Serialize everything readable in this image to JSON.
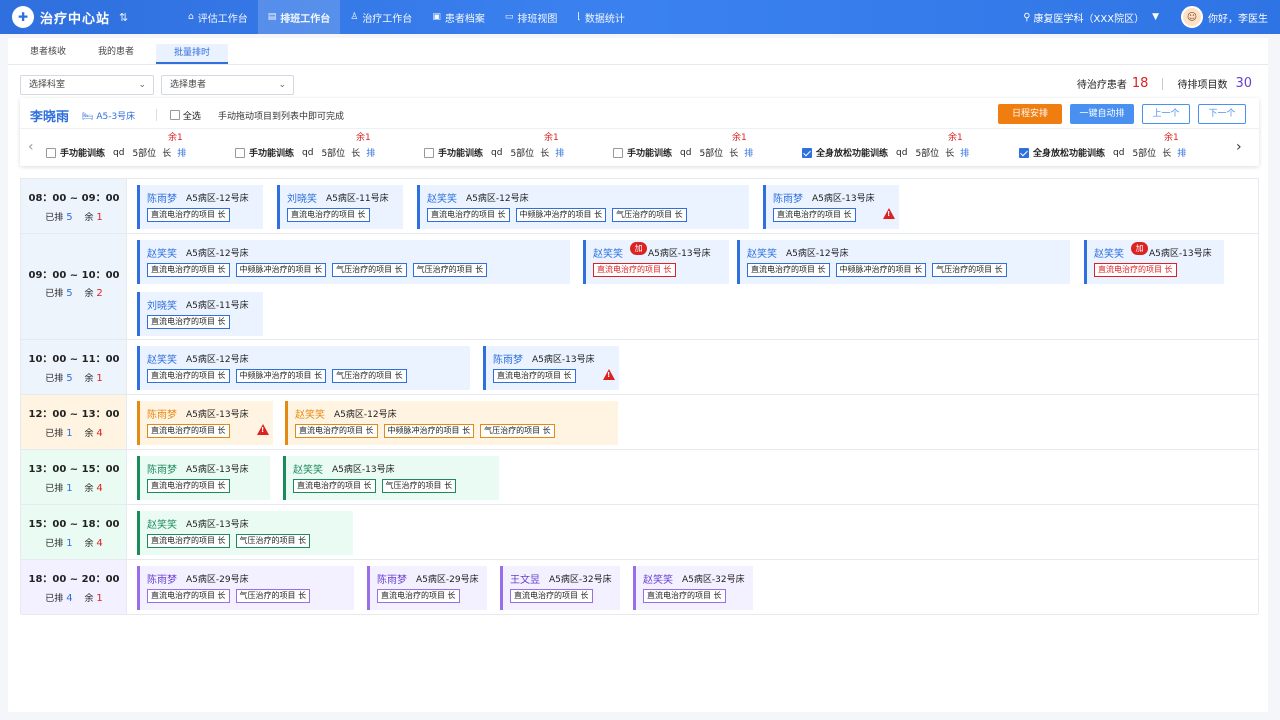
{
  "app": {
    "title": "治疗中心站",
    "swap_icon": "swap-icon"
  },
  "nav": [
    {
      "label": "评估工作台",
      "icon": "assessment-icon",
      "glyph": "⌂"
    },
    {
      "label": "排班工作台",
      "icon": "schedule-icon",
      "glyph": "▤",
      "active": true
    },
    {
      "label": "治疗工作台",
      "icon": "treatment-icon",
      "glyph": "♙"
    },
    {
      "label": "患者档案",
      "icon": "archive-icon",
      "glyph": "▣"
    },
    {
      "label": "排班视图",
      "icon": "view-icon",
      "glyph": "▭"
    },
    {
      "label": "数据统计",
      "icon": "stats-icon",
      "glyph": "⌊"
    }
  ],
  "header": {
    "hospital": "康复医学科（XXX院区）",
    "greeting": "你好，李医生"
  },
  "subtabs": [
    "患者核收",
    "我的患者",
    "批量排时"
  ],
  "filters": {
    "dept_placeholder": "选择科室",
    "patient_placeholder": "选择患者"
  },
  "counts": {
    "pending_patients_label": "待治疗患者",
    "pending_patients": "18",
    "pending_items_label": "待排项目数",
    "pending_items": "30"
  },
  "patient": {
    "name": "李晓雨",
    "bed": "A5-3号床",
    "select_all": "全选",
    "hint": "手动拖动项目到列表中即可完成",
    "buttons": {
      "arrange": "日程安排",
      "auto": "一键自动排",
      "prev": "上一个",
      "next": "下一个"
    },
    "programs": [
      {
        "remain": "余1",
        "name": "手功能训练",
        "freq": "qd",
        "parts": "5部位",
        "long": "长",
        "action": "排",
        "checked": false
      },
      {
        "remain": "余1",
        "name": "手功能训练",
        "freq": "qd",
        "parts": "5部位",
        "long": "长",
        "action": "排",
        "checked": false
      },
      {
        "remain": "余1",
        "name": "手功能训练",
        "freq": "qd",
        "parts": "5部位",
        "long": "长",
        "action": "排",
        "checked": false
      },
      {
        "remain": "余1",
        "name": "手功能训练",
        "freq": "qd",
        "parts": "5部位",
        "long": "长",
        "action": "排",
        "checked": false
      },
      {
        "remain": "余1",
        "name": "全身放松功能训练",
        "freq": "qd",
        "parts": "5部位",
        "long": "长",
        "action": "排",
        "checked": true
      },
      {
        "remain": "余1",
        "name": "全身放松功能训练",
        "freq": "qd",
        "parts": "5部位",
        "long": "长",
        "action": "排",
        "checked": true
      }
    ]
  },
  "schedule": [
    {
      "time": "08：00 ~ 09：00",
      "scheduled_label": "已排",
      "scheduled": "5",
      "remain_label": "余",
      "remain": "1",
      "color": "blue",
      "patients": [
        {
          "name": "陈雨梦",
          "bed": "A5病区-12号床",
          "items": [
            {
              "t": "直流电治疗的项目  长"
            }
          ]
        },
        {
          "name": "刘晓笑",
          "bed": "A5病区-11号床",
          "items": [
            {
              "t": "直流电治疗的项目  长"
            }
          ]
        },
        {
          "name": "赵笑笑",
          "bed": "A5病区-12号床",
          "items": [
            {
              "t": "直流电治疗的项目  长"
            },
            {
              "t": "中频脉冲治疗的项目  长"
            },
            {
              "t": "气压治疗的项目  长"
            }
          ]
        },
        {
          "name": "陈雨梦",
          "bed": "A5病区-13号床",
          "items": [
            {
              "t": "直流电治疗的项目  长"
            }
          ],
          "warn": true
        }
      ]
    },
    {
      "time": "09：00 ~ 10：00",
      "scheduled_label": "已排",
      "scheduled": "5",
      "remain_label": "余",
      "remain": "2",
      "color": "blue",
      "patients": [
        {
          "name": "赵笑笑",
          "bed": "A5病区-12号床",
          "items": [
            {
              "t": "直流电治疗的项目  长"
            },
            {
              "t": "中频脉冲治疗的项目  长"
            },
            {
              "t": "气压治疗的项目  长"
            },
            {
              "t": "气压治疗的项目  长"
            }
          ]
        },
        {
          "name": "赵笑笑",
          "bed": "A5病区-13号床",
          "jia": "加",
          "items": [
            {
              "t": "直流电治疗的项目  长",
              "red": true
            }
          ]
        },
        {
          "name": "赵笑笑",
          "bed": "A5病区-12号床",
          "items": [
            {
              "t": "直流电治疗的项目  长"
            },
            {
              "t": "中频脉冲治疗的项目  长"
            },
            {
              "t": "气压治疗的项目  长"
            }
          ]
        },
        {
          "name": "赵笑笑",
          "bed": "A5病区-13号床",
          "jia": "加",
          "items": [
            {
              "t": "直流电治疗的项目  长",
              "red": true
            }
          ]
        },
        {
          "name": "刘晓笑",
          "bed": "A5病区-11号床",
          "items": [
            {
              "t": "直流电治疗的项目  长"
            }
          ]
        }
      ]
    },
    {
      "time": "10：00 ~ 11：00",
      "scheduled_label": "已排",
      "scheduled": "5",
      "remain_label": "余",
      "remain": "1",
      "color": "blue",
      "patients": [
        {
          "name": "赵笑笑",
          "bed": "A5病区-12号床",
          "items": [
            {
              "t": "直流电治疗的项目  长"
            },
            {
              "t": "中频脉冲治疗的项目  长"
            },
            {
              "t": "气压治疗的项目  长"
            }
          ]
        },
        {
          "name": "陈雨梦",
          "bed": "A5病区-13号床",
          "items": [
            {
              "t": "直流电治疗的项目  长"
            }
          ],
          "warn": true
        }
      ]
    },
    {
      "time": "12：00 ~ 13：00",
      "scheduled_label": "已排",
      "scheduled": "1",
      "remain_label": "余",
      "remain": "4",
      "color": "orange",
      "patients": [
        {
          "name": "陈雨梦",
          "bed": "A5病区-13号床",
          "items": [
            {
              "t": "直流电治疗的项目  长"
            }
          ],
          "warn": true
        },
        {
          "name": "赵笑笑",
          "bed": "A5病区-12号床",
          "items": [
            {
              "t": "直流电治疗的项目  长"
            },
            {
              "t": "中频脉冲治疗的项目  长"
            },
            {
              "t": "气压治疗的项目  长"
            }
          ]
        }
      ]
    },
    {
      "time": "13：00 ~ 15：00",
      "scheduled_label": "已排",
      "scheduled": "1",
      "remain_label": "余",
      "remain": "4",
      "color": "green",
      "patients": [
        {
          "name": "陈雨梦",
          "bed": "A5病区-13号床",
          "items": [
            {
              "t": "直流电治疗的项目  长"
            }
          ]
        },
        {
          "name": "赵笑笑",
          "bed": "A5病区-13号床",
          "items": [
            {
              "t": "直流电治疗的项目  长"
            },
            {
              "t": "气压治疗的项目  长"
            }
          ]
        }
      ]
    },
    {
      "time": "15：00 ~ 18：00",
      "scheduled_label": "已排",
      "scheduled": "1",
      "remain_label": "余",
      "remain": "4",
      "color": "green",
      "patients": [
        {
          "name": "赵笑笑",
          "bed": "A5病区-13号床",
          "items": [
            {
              "t": "直流电治疗的项目  长"
            },
            {
              "t": "气压治疗的项目  长"
            }
          ]
        }
      ]
    },
    {
      "time": "18：00 ~ 20：00",
      "scheduled_label": "已排",
      "scheduled": "4",
      "remain_label": "余",
      "remain": "1",
      "color": "purple",
      "patients": [
        {
          "name": "陈雨梦",
          "bed": "A5病区-29号床",
          "items": [
            {
              "t": "直流电治疗的项目  长"
            },
            {
              "t": "气压治疗的项目  长"
            }
          ]
        },
        {
          "name": "陈雨梦",
          "bed": "A5病区-29号床",
          "items": [
            {
              "t": "直流电治疗的项目  长"
            }
          ]
        },
        {
          "name": "王文昱",
          "bed": "A5病区-32号床",
          "items": [
            {
              "t": "直流电治疗的项目  长"
            }
          ]
        },
        {
          "name": "赵笑笑",
          "bed": "A5病区-32号床",
          "items": [
            {
              "t": "直流电治疗的项目  长"
            }
          ]
        }
      ]
    }
  ],
  "colors": {
    "primary": "#2f6fde",
    "orange": "#f07d10",
    "danger": "#dd2222",
    "green": "#1d8a5c",
    "purple": "#9a6ee8"
  }
}
